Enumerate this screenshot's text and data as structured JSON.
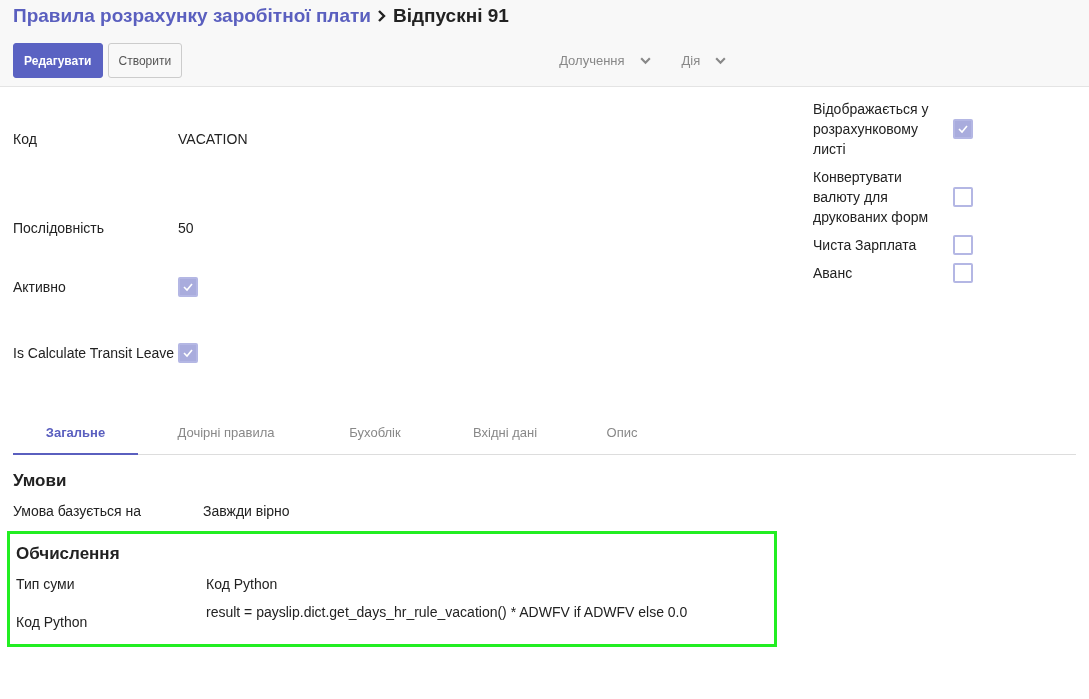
{
  "breadcrumb": {
    "parent": "Правила розрахунку заробітної плати",
    "current": "Відпускні 91"
  },
  "buttons": [
    {
      "label": "Редагувати",
      "kind": "primary"
    },
    {
      "label": "Створити",
      "kind": "secondary"
    }
  ],
  "dropdowns": [
    "Долучення",
    "Дія"
  ],
  "fields_left": [
    {
      "label": "Код",
      "kind": "text",
      "value": "VACATION"
    },
    {
      "label": "Послідовність",
      "kind": "text",
      "value": "50"
    },
    {
      "label": "Активно",
      "kind": "checkbox",
      "checked": true
    },
    {
      "label": "Is Calculate Transit Leave",
      "kind": "checkbox",
      "checked": true
    }
  ],
  "fields_right": [
    {
      "label": "Відображається у розрахунковому листі",
      "checked": true
    },
    {
      "label": "Конвертувати валюту для друкованих форм",
      "checked": false
    },
    {
      "label": "Чиста Зарплата",
      "checked": false
    },
    {
      "label": "Аванс",
      "checked": false
    }
  ],
  "tabs": [
    {
      "label": "Загальне",
      "selected": true
    },
    {
      "label": "Дочірні правила",
      "selected": false
    },
    {
      "label": "Бухоблік",
      "selected": false
    },
    {
      "label": "Вхідні дані",
      "selected": false
    },
    {
      "label": "Опис",
      "selected": false
    }
  ],
  "sections": [
    {
      "title": "Умови",
      "highlighted": false,
      "rows": [
        {
          "label": "Умова базується на",
          "value": "Завжди вірно"
        }
      ]
    },
    {
      "title": "Обчислення",
      "highlighted": true,
      "rows": [
        {
          "label": "Тип суми",
          "value": "Код Python"
        },
        {
          "label": "Код Python",
          "value": "result = payslip.dict.get_days_hr_rule_vacation() * ADWFV if ADWFV else 0.0"
        }
      ]
    }
  ]
}
